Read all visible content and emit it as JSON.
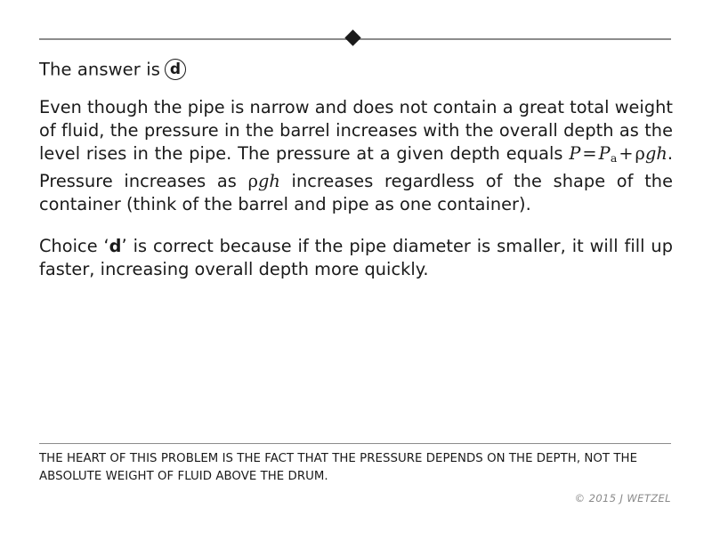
{
  "document": {
    "answer": {
      "prefix": "The answer is",
      "choice_letter": "d"
    },
    "paragraphs": [
      {
        "segments": [
          {
            "type": "text",
            "value": "Even though the pipe is narrow and does not contain a great total weight of fluid, the pressure in the barrel increases with the overall depth as the level rises in the pipe.  The pressure at a given depth equals "
          },
          {
            "type": "math",
            "value": "P = P_a + ρgh"
          },
          {
            "type": "text",
            "value": ".  Pressure increases as "
          },
          {
            "type": "math",
            "value": "ρgh"
          },
          {
            "type": "text",
            "value": " increases regardless of the shape of the container (think of the barrel and pipe as one container)."
          }
        ],
        "equation": {
          "P": "P",
          "equals": "=",
          "P_symbol": "P",
          "subscript": "a",
          "plus": "+",
          "rho": "ρ",
          "gh": "gh",
          "period": "."
        },
        "inline_math": {
          "rho": "ρ",
          "gh": "gh"
        },
        "text_before_equation": "Even though the pipe is narrow and does not contain a great total weight of fluid, the pressure in the barrel increases with the overall depth as the level rises in the pipe.  The pressure at a given depth equals ",
        "text_between": ".  Pressure increases as ",
        "text_after": " increases regardless of the shape of the container (think of the barrel and pipe as one container)."
      }
    ],
    "choice_paragraph": {
      "before": "Choice ‘",
      "letter": "d",
      "after": "’ is correct because if the pipe diameter is smaller, it will fill up faster, increasing overall depth more quickly."
    },
    "footer_note": "THE HEART OF THIS PROBLEM IS THE FACT THAT THE PRESSURE DEPENDS ON THE DEPTH, NOT THE ABSOLUTE WEIGHT OF FLUID ABOVE THE DRUM.",
    "copyright": "© 2015 J WETZEL"
  },
  "colors": {
    "text": "#1a1a1a",
    "rule": "#8c8c8c",
    "copyright": "#8a8a8a",
    "background": "#ffffff"
  }
}
